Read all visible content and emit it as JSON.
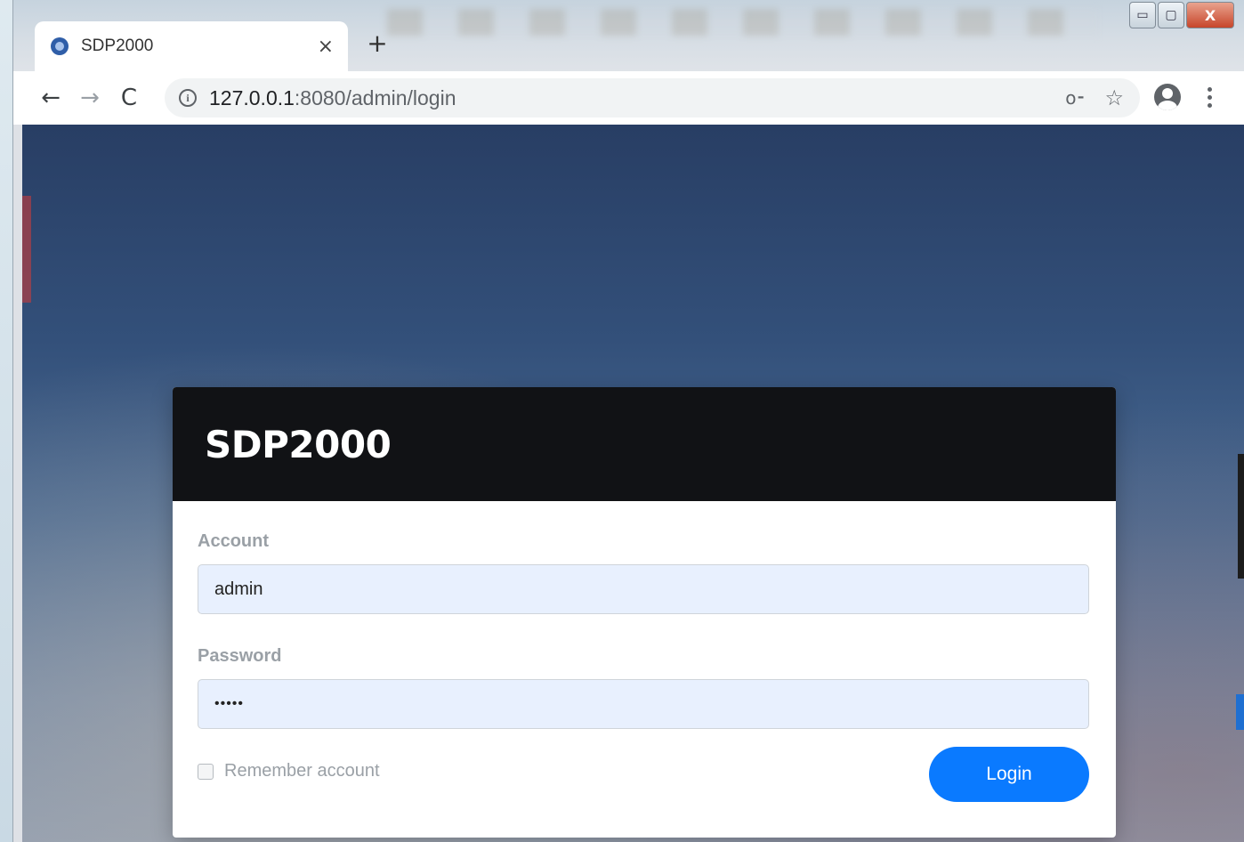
{
  "browser": {
    "tab": {
      "title": "SDP2000",
      "close_label": "×",
      "favicon_icon": "sdp-favicon-icon"
    },
    "new_tab_label": "+",
    "window_controls": {
      "minimize_label": "▭",
      "maximize_label": "▢",
      "close_label": "X"
    },
    "nav": {
      "back_label": "←",
      "forward_label": "→",
      "reload_label": "C"
    },
    "address": {
      "info_label": "i",
      "host": "127.0.0.1",
      "path": ":8080/admin/login"
    },
    "omnibox_icons": {
      "key_label": "o⁃",
      "star_label": "☆"
    }
  },
  "login": {
    "title": "SDP2000",
    "account_label": "Account",
    "account_value": "admin",
    "password_label": "Password",
    "password_value": "•••••",
    "remember_label": "Remember account",
    "remember_checked": false,
    "login_button_label": "Login"
  },
  "colors": {
    "login_button": "#0a7aff",
    "card_header": "#111215",
    "input_background": "#e8f0fe"
  }
}
